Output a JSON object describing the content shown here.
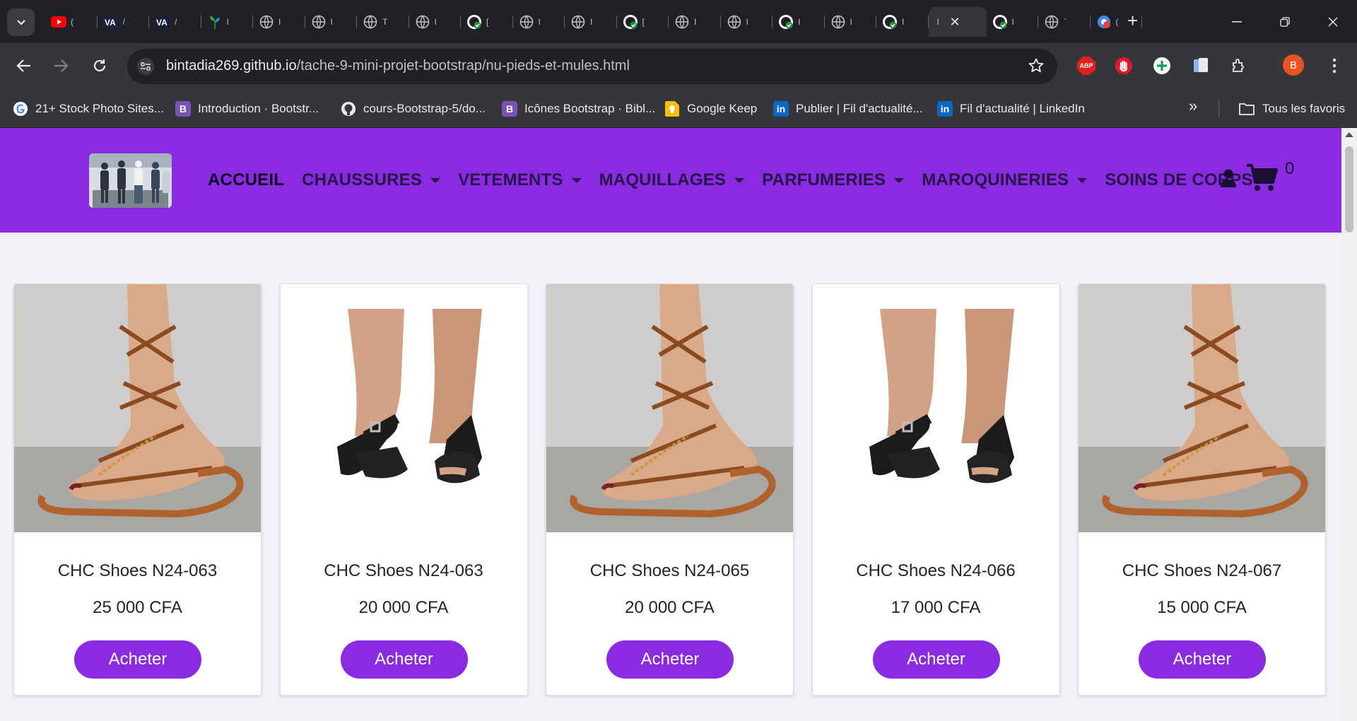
{
  "browser": {
    "tabs": [
      {
        "icon": "youtube-icon",
        "title": "("
      },
      {
        "icon": "va-icon",
        "title": "/"
      },
      {
        "icon": "va-icon",
        "title": "/"
      },
      {
        "icon": "plant-icon",
        "title": "I"
      },
      {
        "icon": "globe-icon",
        "title": "I"
      },
      {
        "icon": "globe-icon",
        "title": "I"
      },
      {
        "icon": "globe-icon",
        "title": "T"
      },
      {
        "icon": "globe-icon",
        "title": "I"
      },
      {
        "icon": "github-check-icon",
        "title": "["
      },
      {
        "icon": "globe-icon",
        "title": "I"
      },
      {
        "icon": "globe-icon",
        "title": "I"
      },
      {
        "icon": "github-check-icon",
        "title": "["
      },
      {
        "icon": "globe-icon",
        "title": "I"
      },
      {
        "icon": "globe-icon",
        "title": "I"
      },
      {
        "icon": "github-check-icon",
        "title": "I"
      },
      {
        "icon": "globe-icon",
        "title": "I"
      },
      {
        "icon": "github-check-icon",
        "title": "I"
      }
    ],
    "active_tab": {
      "title": "I",
      "close": "✕"
    },
    "tabs_after": [
      {
        "icon": "github-check-icon",
        "title": "I"
      },
      {
        "icon": "globe-icon",
        "title": "`"
      },
      {
        "icon": "chrome-badge-icon",
        "title": "("
      }
    ],
    "new_tab": "+",
    "url_host": "bintadia269.github.io",
    "url_path": "/tache-9-mini-projet-bootstrap/nu-pieds-et-mules.html",
    "profile_initial": "B",
    "abp_label": "ABP",
    "bookmarks": [
      {
        "label": "21+ Stock Photo Sites...",
        "icon": "google-icon",
        "letter": "G",
        "color": "#ffffff"
      },
      {
        "label": "Introduction · Bootstr...",
        "icon": "bootstrap-icon",
        "letter": "B",
        "color": "#7952b3"
      },
      {
        "label": "cours-Bootstrap-5/do...",
        "icon": "github-icon",
        "letter": "",
        "color": "#35363a"
      },
      {
        "label": "Icônes Bootstrap · Bibl...",
        "icon": "bootstrap-icon",
        "letter": "B",
        "color": "#7952b3"
      },
      {
        "label": "Google Keep",
        "icon": "google-keep-icon",
        "letter": "",
        "color": "#fbbc04"
      },
      {
        "label": "Publier | Fil d'actualité...",
        "icon": "linkedin-icon",
        "letter": "in",
        "color": "#0a66c2"
      },
      {
        "label": "Fil d'actualité | LinkedIn",
        "icon": "linkedin-icon",
        "letter": "in",
        "color": "#0a66c2"
      }
    ],
    "bookmarks_overflow": "»",
    "all_bookmarks": "Tous les favoris"
  },
  "site": {
    "brand_color": "#8a2be2",
    "nav": [
      {
        "label": "ACCUEIL",
        "dropdown": false
      },
      {
        "label": "CHAUSSURES",
        "dropdown": true
      },
      {
        "label": "VETEMENTS",
        "dropdown": true
      },
      {
        "label": "MAQUILLAGES",
        "dropdown": true
      },
      {
        "label": "PARFUMERIES",
        "dropdown": true
      },
      {
        "label": "MAROQUINERIES",
        "dropdown": true
      },
      {
        "label": "SOINS DE CORPS",
        "dropdown": true
      }
    ],
    "cart_count": "0"
  },
  "products": [
    {
      "title": "CHC Shoes N24-063",
      "price": "25 000 CFA",
      "button": "Acheter",
      "image": "lace-up-tan-sandal"
    },
    {
      "title": "CHC Shoes N24-063",
      "price": "20 000 CFA",
      "button": "Acheter",
      "image": "black-strap-sandal"
    },
    {
      "title": "CHC Shoes N24-065",
      "price": "20 000 CFA",
      "button": "Acheter",
      "image": "lace-up-tan-sandal"
    },
    {
      "title": "CHC Shoes N24-066",
      "price": "17 000 CFA",
      "button": "Acheter",
      "image": "black-strap-sandal"
    },
    {
      "title": "CHC Shoes N24-067",
      "price": "15 000 CFA",
      "button": "Acheter",
      "image": "lace-up-tan-sandal"
    }
  ]
}
